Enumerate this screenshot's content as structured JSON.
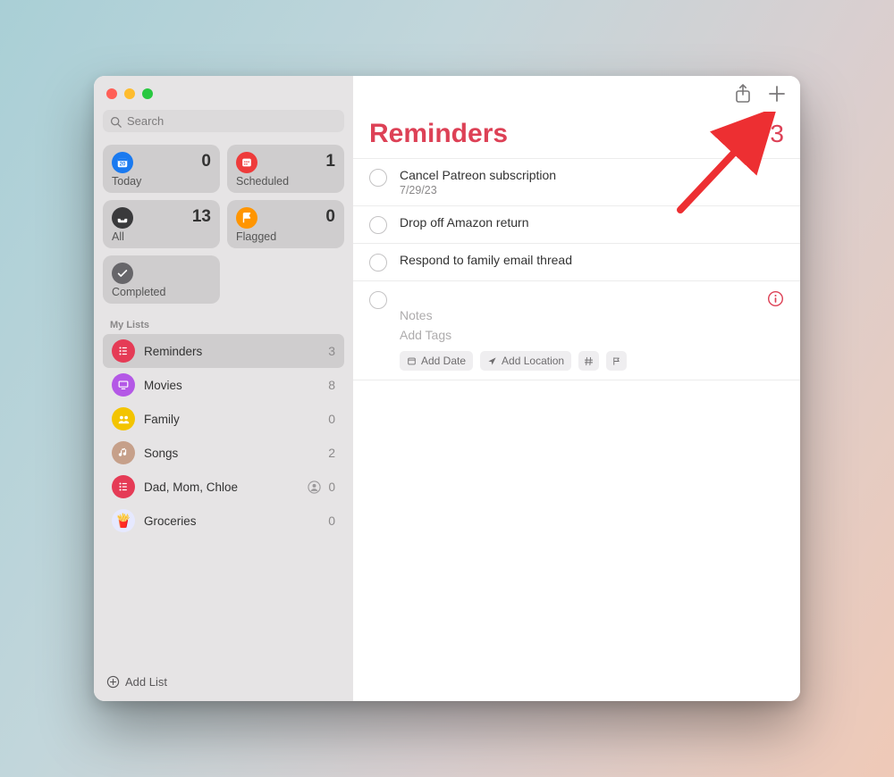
{
  "search": {
    "placeholder": "Search"
  },
  "smart": {
    "today": {
      "label": "Today",
      "count": 0
    },
    "scheduled": {
      "label": "Scheduled",
      "count": 1
    },
    "all": {
      "label": "All",
      "count": 13
    },
    "flagged": {
      "label": "Flagged",
      "count": 0
    },
    "completed": {
      "label": "Completed"
    }
  },
  "sectionHeader": "My Lists",
  "lists": [
    {
      "name": "Reminders",
      "count": 3,
      "color": "#e53b56",
      "icon": "list",
      "selected": true
    },
    {
      "name": "Movies",
      "count": 8,
      "color": "#b458e6",
      "icon": "display"
    },
    {
      "name": "Family",
      "count": 0,
      "color": "#f3c400",
      "icon": "people"
    },
    {
      "name": "Songs",
      "count": 2,
      "color": "#c6a08a",
      "icon": "music"
    },
    {
      "name": "Dad, Mom, Chloe",
      "count": 0,
      "color": "#e53b56",
      "icon": "list",
      "shared": true
    },
    {
      "name": "Groceries",
      "count": 0,
      "icon": "groceries"
    }
  ],
  "addList": "Add List",
  "main": {
    "title": "Reminders",
    "count": 3,
    "items": [
      {
        "title": "Cancel Patreon subscription",
        "sub": "7/29/23"
      },
      {
        "title": "Drop off Amazon return"
      },
      {
        "title": "Respond to family email thread"
      }
    ],
    "newItem": {
      "notesPlaceholder": "Notes",
      "tagsPlaceholder": "Add Tags",
      "chipDate": "Add Date",
      "chipLocation": "Add Location"
    }
  }
}
